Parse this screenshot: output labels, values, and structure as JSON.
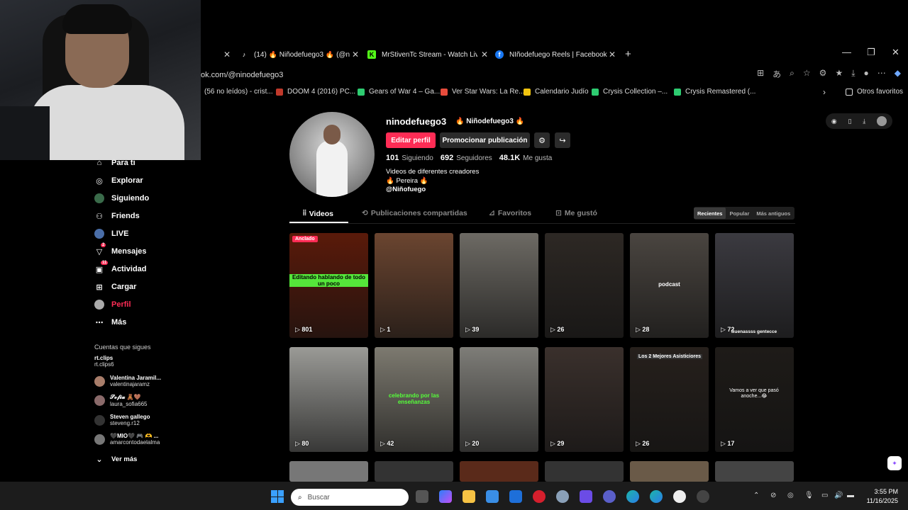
{
  "browser": {
    "tabs": [
      {
        "title": "(14) 🔥 Niñodefuego3 🔥 (@ninod",
        "icon": "tiktok-icon",
        "color": "#000000"
      },
      {
        "title": "MrStivenTc Stream - Watch Live o",
        "icon": "kick-icon",
        "color": "#53fc18"
      },
      {
        "title": "NIñodefuego Reels | Facebook",
        "icon": "facebook-icon",
        "color": "#1877f2"
      }
    ],
    "new_tab": "+",
    "close": "✕",
    "url": "ok.com/@ninodefuego3",
    "bookmarks": [
      "(56 no leídos) - crist...",
      "DOOM 4 (2016) PC...",
      "Gears of War 4 – Ga...",
      "Ver Star Wars: La Re...",
      "Calendario Judío",
      "Crysis Collection –...",
      "Crysis Remastered (..."
    ],
    "other_favorites": "Otros favoritos"
  },
  "nav": {
    "items": [
      {
        "label": "Para ti",
        "icon": "home-icon"
      },
      {
        "label": "Explorar",
        "icon": "compass-icon"
      },
      {
        "label": "Siguiendo",
        "icon": "following-icon"
      },
      {
        "label": "Friends",
        "icon": "friends-icon"
      },
      {
        "label": "LIVE",
        "icon": "live-icon"
      },
      {
        "label": "Mensajes",
        "icon": "messages-icon",
        "badge": "2"
      },
      {
        "label": "Actividad",
        "icon": "activity-icon",
        "badge": "11"
      },
      {
        "label": "Cargar",
        "icon": "upload-icon"
      },
      {
        "label": "Perfil",
        "icon": "profile-icon"
      },
      {
        "label": "Más",
        "icon": "more-icon"
      }
    ],
    "following_title": "Cuentas que sigues",
    "following": [
      {
        "name": "rt.clips",
        "handle": "rt.clips6"
      },
      {
        "name": "Valentina Jaramil...",
        "handle": "valentinajaramz"
      },
      {
        "name": "𝓢𝓸𝓯𝓲𝓪 🧸🤎",
        "handle": "laura_sofia665"
      },
      {
        "name": "Steven gallego",
        "handle": "steveng.r12"
      },
      {
        "name": "🖤MIO🖤 🎮 🫶 ...",
        "handle": "amarcontodaelalma"
      }
    ],
    "see_more": "Ver más"
  },
  "profile": {
    "username": "ninodefuego3",
    "display_name": "🔥 Niñodefuego3 🔥",
    "edit_button": "Editar perfil",
    "promote_button": "Promocionar publicación",
    "stats": [
      {
        "value": "101",
        "label": "Siguiendo"
      },
      {
        "value": "692",
        "label": "Seguidores"
      },
      {
        "value": "48.1K",
        "label": "Me gusta"
      }
    ],
    "bio_lines": [
      "Videos de diferentes creadores",
      "🔥 Pereira 🔥",
      "@Niñofuego"
    ],
    "tabs": [
      "Videos",
      "Publicaciones compartidas",
      "Favoritos",
      "Me gustó"
    ],
    "sort": [
      "Recientes",
      "Popular",
      "Más antiguos"
    ]
  },
  "videos": [
    {
      "views": "801",
      "pinned": "Anclado",
      "overlay": "Editando hablando de todo un poco",
      "color": "#5a1a0a"
    },
    {
      "views": "1",
      "overlay": "",
      "color": "#6b4530"
    },
    {
      "views": "39",
      "overlay": "",
      "color": "#6d6a64"
    },
    {
      "views": "26",
      "overlay": "",
      "color": "#2d2824"
    },
    {
      "views": "28",
      "overlay": "podcast",
      "color": "#4a4540"
    },
    {
      "views": "72",
      "overlay": "Buenassss gentecce",
      "color": "#3b3a40"
    },
    {
      "views": "80",
      "overlay": "",
      "color": "#9a9a96"
    },
    {
      "views": "42",
      "overlay": "celebrando por las enseñanzas",
      "color": "#7d7a70"
    },
    {
      "views": "20",
      "overlay": "",
      "color": "#7e7d78"
    },
    {
      "views": "29",
      "overlay": "",
      "color": "#3a302c"
    },
    {
      "views": "26",
      "overlay": "Los 2 Mejores Asisticiores",
      "color": "#26201c"
    },
    {
      "views": "17",
      "overlay": "Vamos a ver que pasó anoche...😂",
      "color": "#1e1b18"
    }
  ],
  "taskbar": {
    "search_placeholder": "Buscar",
    "time": "3:55 PM",
    "date": "11/16/2025"
  }
}
